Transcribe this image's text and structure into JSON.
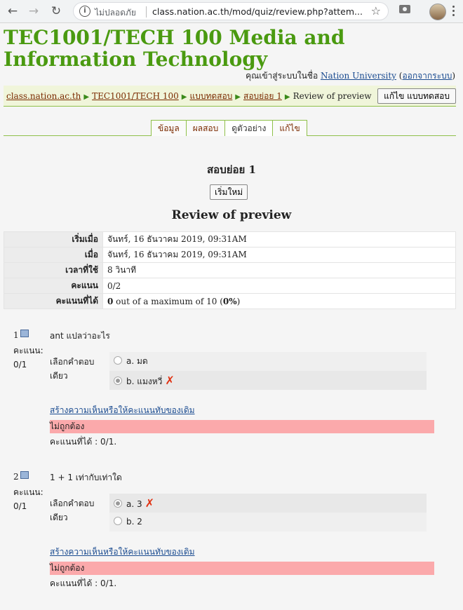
{
  "browser": {
    "security_label": "ไม่ปลอดภัย",
    "url": "class.nation.ac.th/mod/quiz/review.php?attem..."
  },
  "course_title": "TEC1001/TECH 100 Media and Information Technology",
  "login": {
    "prefix": "คุณเข้าสู่ระบบในชื่อ",
    "user": "Nation University",
    "logout": "ออกจากระบบ"
  },
  "breadcrumb": {
    "site": "class.nation.ac.th",
    "course": "TEC1001/TECH 100",
    "quizzes": "แบบทดสอบ",
    "quiz": "สอบย่อย 1",
    "current": "Review of preview"
  },
  "edit_quiz_button": "แก้ไข แบบทดสอบ",
  "tabs": [
    "ข้อมูล",
    "ผลสอบ",
    "ดูตัวอย่าง",
    "แก้ไข"
  ],
  "quiz_name": "สอบย่อย 1",
  "restart_button": "เริ่มใหม่",
  "review_heading": "Review of preview",
  "summary": [
    {
      "label": "เริ่มเมื่อ",
      "value": "จันทร์, 16 ธันวาคม 2019, 09:31AM"
    },
    {
      "label": "เมื่อ",
      "value": "จันทร์, 16 ธันวาคม 2019, 09:31AM"
    },
    {
      "label": "เวลาที่ใช้",
      "value": "8 วินาที"
    },
    {
      "label": "คะแนน",
      "value": "0/2"
    },
    {
      "label": "คะแนนที่ได้",
      "value_bold": "0",
      "value_mid": " out of a maximum of 10 (",
      "value_pct": "0%",
      "value_end": ")"
    }
  ],
  "questions": [
    {
      "number": "1",
      "score_label": "คะแนน:",
      "score": "0/1",
      "text": "ant แปลว่าอะไร",
      "type_label": "เลือกคำตอบเดียว",
      "options": [
        {
          "label": "a. มด",
          "selected": false,
          "wrong": false
        },
        {
          "label": "b. แมงหวี่",
          "selected": true,
          "wrong": true
        }
      ],
      "comment_link": "สร้างความเห็นหรือให้คะแนนทับของเดิม",
      "feedback": "ไม่ถูกต้อง",
      "marks": "คะแนนที่ได้ : 0/1."
    },
    {
      "number": "2",
      "score_label": "คะแนน:",
      "score": "0/1",
      "text": "1 + 1 เท่ากับเท่าใด",
      "type_label": "เลือกคำตอบเดียว",
      "options": [
        {
          "label": "a. 3",
          "selected": true,
          "wrong": true
        },
        {
          "label": "b. 2",
          "selected": false,
          "wrong": false
        }
      ],
      "comment_link": "สร้างความเห็นหรือให้คะแนนทับของเดิม",
      "feedback": "ไม่ถูกต้อง",
      "marks": "คะแนนที่ได้ : 0/1."
    }
  ]
}
